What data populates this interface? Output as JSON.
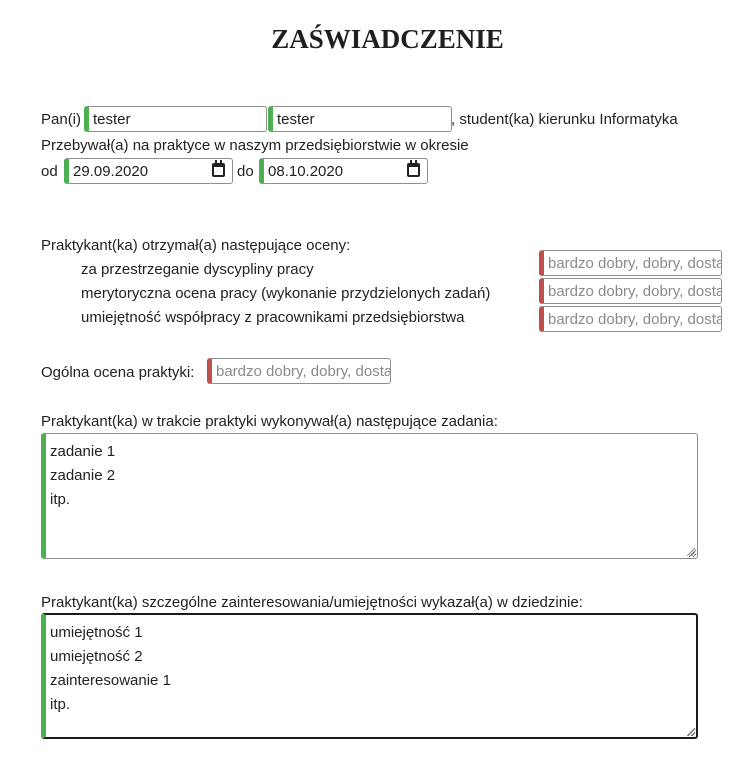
{
  "title": "ZAŚWIADCZENIE",
  "student": {
    "prefix": "Pan(i)",
    "first_name": "tester",
    "last_name": "tester",
    "suffix": ", student(ka) kierunku Informatyka"
  },
  "period": {
    "line": "Przebywał(a) na praktyce w naszym przedsiębiorstwie w okresie",
    "from_label": "od",
    "from_value": "29.09.2020",
    "to_label": "do",
    "to_value": "08.10.2020"
  },
  "grades": {
    "heading": "Praktykant(ka) otrzymał(a) następujące oceny:",
    "items": [
      {
        "label": "za przestrzeganie dyscypliny pracy",
        "placeholder": "bardzo dobry, dobry, dostateczny"
      },
      {
        "label": "merytoryczna ocena pracy (wykonanie przydzielonych zadań)",
        "placeholder": "bardzo dobry, dobry, dostateczny"
      },
      {
        "label": "umiejętność współpracy z pracownikami przedsiębiorstwa",
        "placeholder": "bardzo dobry, dobry, dostateczny"
      }
    ]
  },
  "overall": {
    "label": "Ogólna ocena praktyki:",
    "placeholder": "bardzo dobry, dobry, dostateczny"
  },
  "tasks": {
    "label": "Praktykant(ka) w trakcie praktyki wykonywał(a) następujące zadania:",
    "value": "zadanie 1\nzadanie 2\nitp."
  },
  "skills": {
    "label": "Praktykant(ka) szczególne zainteresowania/umiejętności wykazał(a) w dziedzinie:",
    "value": "umiejętność 1\numiejętność 2\nzainteresowanie 1\nitp."
  }
}
